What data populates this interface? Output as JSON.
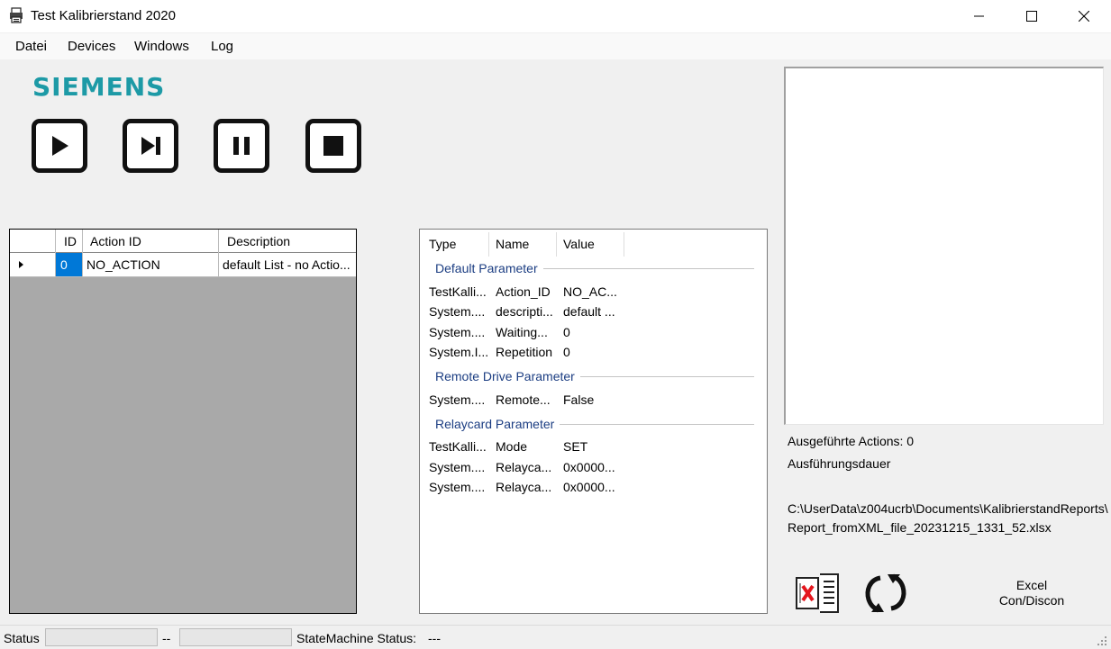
{
  "window": {
    "title": "Test Kalibrierstand 2020",
    "icon": "printer-icon"
  },
  "menu": {
    "items": [
      "Datei",
      "Devices",
      "Windows",
      "Log"
    ]
  },
  "brand": {
    "logo_text": "SIEMENS",
    "logo_color": "#1d9aa6"
  },
  "controls": {
    "buttons": [
      "play-icon",
      "step-icon",
      "pause-icon",
      "stop-icon"
    ]
  },
  "action_grid": {
    "columns": [
      "ID",
      "Action ID",
      "Description"
    ],
    "rows": [
      {
        "id": "0",
        "action_id": "NO_ACTION",
        "description": "default List - no Actio..."
      }
    ],
    "selection_color": "#0078d7"
  },
  "properties": {
    "columns": [
      "Type",
      "Name",
      "Value"
    ],
    "categories": [
      {
        "name": "Default Parameter",
        "rows": [
          {
            "type": "TestKalli...",
            "name": "Action_ID",
            "value": "NO_AC..."
          },
          {
            "type": "System....",
            "name": "descripti...",
            "value": "default ..."
          },
          {
            "type": "System....",
            "name": "Waiting...",
            "value": "0"
          },
          {
            "type": "System.I...",
            "name": "Repetition",
            "value": "0"
          }
        ]
      },
      {
        "name": "Remote Drive Parameter",
        "rows": [
          {
            "type": "System....",
            "name": "Remote...",
            "value": "False"
          }
        ]
      },
      {
        "name": "Relaycard Parameter",
        "rows": [
          {
            "type": "TestKalli...",
            "name": "Mode",
            "value": "SET"
          },
          {
            "type": "System....",
            "name": "Relayca...",
            "value": "0x0000..."
          },
          {
            "type": "System....",
            "name": "Relayca...",
            "value": "0x0000..."
          }
        ]
      }
    ],
    "category_color": "#1b3d82"
  },
  "info": {
    "actions_executed": "Ausgeführte Actions: 0",
    "duration_label": "Ausführungsdauer",
    "report_path_line1": "C:\\UserData\\z004ucrb\\Documents\\KalibrierstandReports\\",
    "report_path_line2": "Report_fromXML_file_20231215_1331_52.xlsx"
  },
  "excel": {
    "label_line1": "Excel",
    "label_line2": "Con/Discon",
    "icon": "excel-disconnected-icon",
    "refresh_icon": "refresh-icon"
  },
  "statusbar": {
    "status_label": "Status",
    "separator": "--",
    "statemachine_label": "StateMachine Status:",
    "statemachine_value": "---"
  }
}
